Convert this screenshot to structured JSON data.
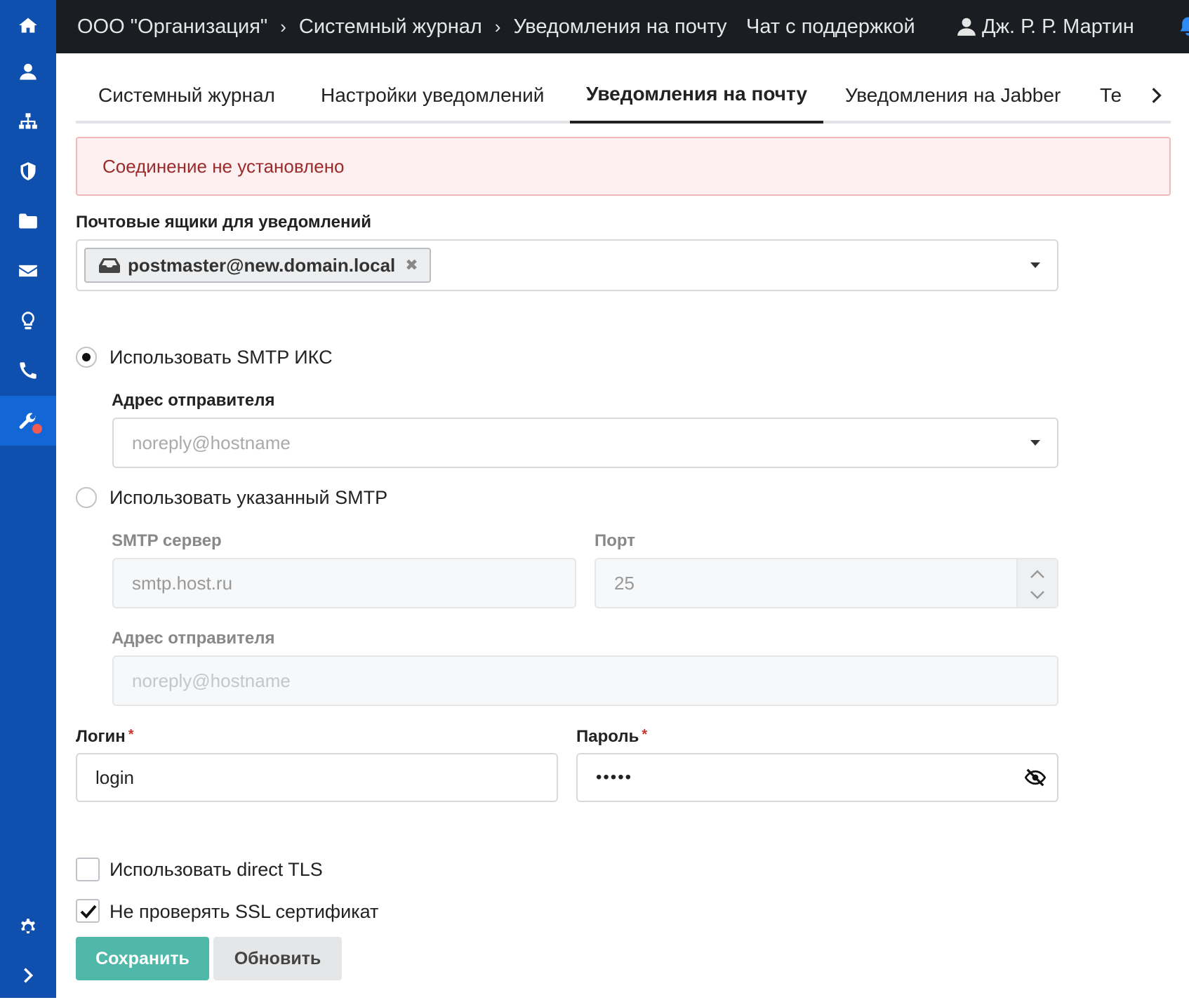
{
  "topbar": {
    "breadcrumbs": [
      "ООО \"Организация\"",
      "Системный журнал",
      "Уведомления на почту"
    ],
    "separator": "›",
    "support_chat": "Чат с поддержкой",
    "user_name": "Дж. Р. Р. Мартин"
  },
  "sidebar": {
    "items": [
      "home-icon",
      "user-icon",
      "sitemap-icon",
      "shield-icon",
      "folder-icon",
      "envelope-icon",
      "lightbulb-icon",
      "phone-icon",
      "wrench-icon"
    ],
    "bottom": [
      "gear-icon",
      "chevron-right-icon"
    ],
    "active": "wrench-icon",
    "accent": "#0f4fae"
  },
  "tabs": {
    "items": [
      "Системный журнал",
      "Настройки уведомлений",
      "Уведомления на почту",
      "Уведомления на Jabber",
      "Те"
    ],
    "active": "Уведомления на почту"
  },
  "alert": {
    "text": "Соединение не установлено"
  },
  "mailboxes": {
    "label": "Почтовые ящики для уведомлений",
    "selected": "postmaster@new.domain.local"
  },
  "smtp_iks": {
    "option": "Использовать SMTP ИКС",
    "sender_label": "Адрес отправителя",
    "sender_placeholder": "noreply@hostname"
  },
  "smtp_custom": {
    "option": "Использовать указанный SMTP",
    "server_label": "SMTP сервер",
    "server_placeholder": "smtp.host.ru",
    "port_label": "Порт",
    "port_value": "25",
    "sender_label": "Адрес отправителя",
    "sender_placeholder": "noreply@hostname"
  },
  "credentials": {
    "login_label": "Логин",
    "login_value": "login",
    "password_label": "Пароль",
    "password_mask": "•••••",
    "required_mark": "*"
  },
  "options": {
    "direct_tls": "Использовать direct TLS",
    "no_ssl_check": "Не проверять SSL сертификат"
  },
  "buttons": {
    "save": "Сохранить",
    "refresh": "Обновить"
  }
}
